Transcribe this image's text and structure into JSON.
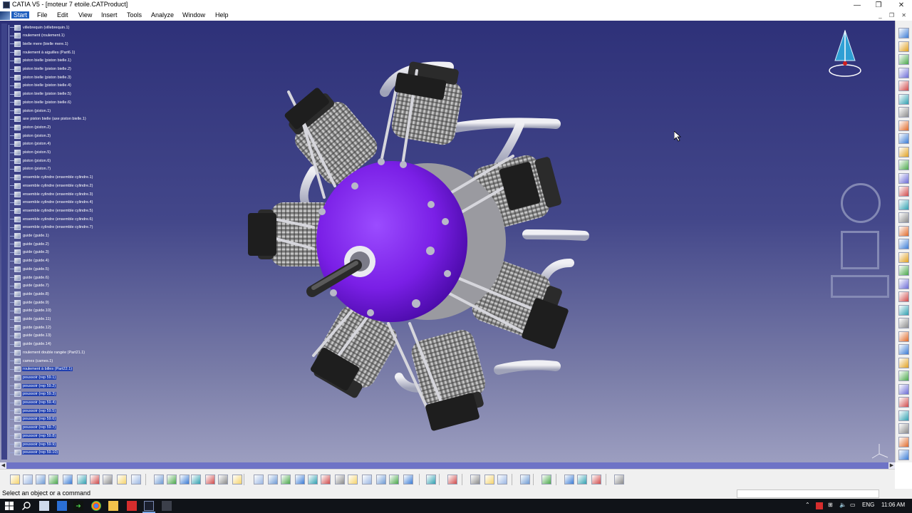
{
  "window": {
    "title": "CATIA V5 - [moteur 7 etoile.CATProduct]",
    "minimize": "—",
    "restore": "❐",
    "close": "✕"
  },
  "menu": {
    "items": [
      {
        "label": "Start"
      },
      {
        "label": "File"
      },
      {
        "label": "Edit"
      },
      {
        "label": "View"
      },
      {
        "label": "Insert"
      },
      {
        "label": "Tools"
      },
      {
        "label": "Analyze"
      },
      {
        "label": "Window"
      },
      {
        "label": "Help"
      }
    ],
    "mdi_controls": "_ ❐ ✕"
  },
  "tree": {
    "items": [
      "villebrequin (villebrequin.1)",
      "roulement (roulement.1)",
      "bielle mere (bielle mere.1)",
      "roulement à aiguilles (Part6.1)",
      "piston bielle (piston bielle.1)",
      "piston bielle (piston bielle.2)",
      "piston bielle (piston bielle.3)",
      "piston bielle (piston bielle.4)",
      "piston bielle (piston bielle.5)",
      "piston bielle (piston bielle.6)",
      "piston (piston.1)",
      "axe piston bielle (axe piston bielle.1)",
      "piston (piston.2)",
      "piston (piston.3)",
      "piston (piston.4)",
      "piston (piston.5)",
      "piston (piston.6)",
      "piston (piston.7)",
      "ensemble cylindre (ensemble cylindre.1)",
      "ensemble cylindre (ensemble cylindre.2)",
      "ensemble cylindre (ensemble cylindre.3)",
      "ensemble cylindre (ensemble cylindre.4)",
      "ensemble cylindre (ensemble cylindre.5)",
      "ensemble cylindre (ensemble cylindre.6)",
      "ensemble cylindre (ensemble cylindre.7)",
      "guide (guide.1)",
      "guide (guide.2)",
      "guide (guide.3)",
      "guide (guide.4)",
      "guide (guide.5)",
      "guide (guide.6)",
      "guide (guide.7)",
      "guide (guide.8)",
      "guide (guide.9)",
      "guide (guide.10)",
      "guide (guide.11)",
      "guide (guide.12)",
      "guide (guide.13)",
      "guide (guide.14)",
      "roulement double rangée (Part21.1)",
      "cames (cames.1)",
      "roulement à billes (Part22.1)",
      "poussoir (rep 59.1)",
      "poussoir (rep 59.2)",
      "poussoir (rep 59.3)",
      "poussoir (rep 59.4)",
      "poussoir (rep 59.5)",
      "poussoir (rep 59.6)",
      "poussoir (rep 59.7)",
      "poussoir (rep 59.8)",
      "poussoir (rep 59.9)",
      "poussoir (rep 59.10)"
    ],
    "selected_from_index": 41
  },
  "status": {
    "text": "Select an object or a command"
  },
  "taskbar": {
    "language": "ENG",
    "time": "11:06 AM"
  },
  "colors": {
    "viewport_top": "#2e3179",
    "viewport_bottom": "#9c9ec0",
    "hub": "#7a1fe6",
    "selection": "#1f3fb0"
  }
}
